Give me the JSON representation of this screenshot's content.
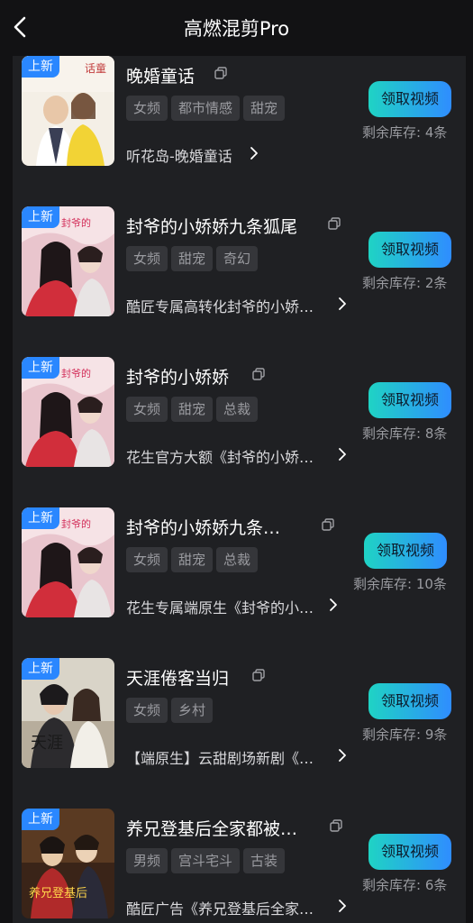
{
  "header": {
    "title": "高燃混剪Pro"
  },
  "new_badge": "上新",
  "get_button_label": "领取视频",
  "colors": {
    "accent_start": "#1fd3c4",
    "accent_end": "#2f8dff",
    "badge": "#2a87ff"
  },
  "items": [
    {
      "title": "晚婚童话",
      "tags": [
        "女频",
        "都市情感",
        "甜宠"
      ],
      "source": "听花岛-晚婚童话",
      "stock": "剩余库存: 4条"
    },
    {
      "title": "封爷的小娇娇九条狐尾",
      "tags": [
        "女频",
        "甜宠",
        "奇幻"
      ],
      "source": "酷匠专属高转化封爷的小娇…",
      "stock": "剩余库存: 2条"
    },
    {
      "title": "封爷的小娇娇",
      "tags": [
        "女频",
        "甜宠",
        "总裁"
      ],
      "source": "花生官方大额《封爷的小娇…",
      "stock": "剩余库存: 8条"
    },
    {
      "title": "封爷的小娇娇九条…",
      "tags": [
        "女频",
        "甜宠",
        "总裁"
      ],
      "source": "花生专属端原生《封爷的小…",
      "stock": "剩余库存: 10条"
    },
    {
      "title": "天涯倦客当归",
      "tags": [
        "女频",
        "乡村"
      ],
      "source": "【端原生】云甜剧场新剧《…",
      "stock": "剩余库存: 9条"
    },
    {
      "title": "养兄登基后全家都被…",
      "tags": [
        "男频",
        "宫斗宅斗",
        "古装"
      ],
      "source": "酷匠广告《养兄登基后全家…",
      "stock": "剩余库存: 6条"
    }
  ]
}
